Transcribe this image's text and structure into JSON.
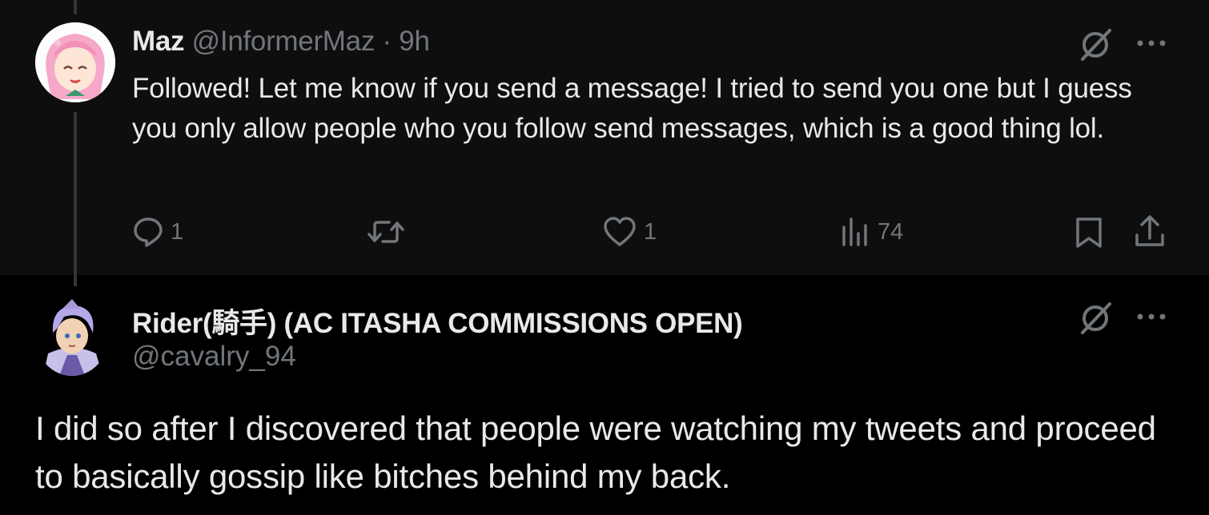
{
  "reply": {
    "author_name": "Maz",
    "handle": "@InformerMaz",
    "separator": "·",
    "time": "9h",
    "text": "Followed! Let me know if you send a message! I tried to send you one but I guess you only allow people who you follow send messages, which is a good thing lol.",
    "actions": {
      "replies": "1",
      "reposts": "",
      "likes": "1",
      "views": "74"
    },
    "icons": [
      "grok-icon",
      "more-icon",
      "reply-icon",
      "repost-icon",
      "like-icon",
      "views-icon",
      "bookmark-icon",
      "share-icon"
    ]
  },
  "main_post": {
    "author_name": "Rider(騎手) (AC ITASHA COMMISSIONS OPEN)",
    "handle": "@cavalry_94",
    "text": "I did so after I discovered that people were watching my tweets and proceed to basically gossip like bitches behind my back.",
    "icons": [
      "grok-icon",
      "more-icon"
    ]
  },
  "colors": {
    "background": "#000000",
    "reply_background": "#0e0e0f",
    "text": "#e7e9ea",
    "muted": "#71767b",
    "thread_line": "#333639"
  }
}
